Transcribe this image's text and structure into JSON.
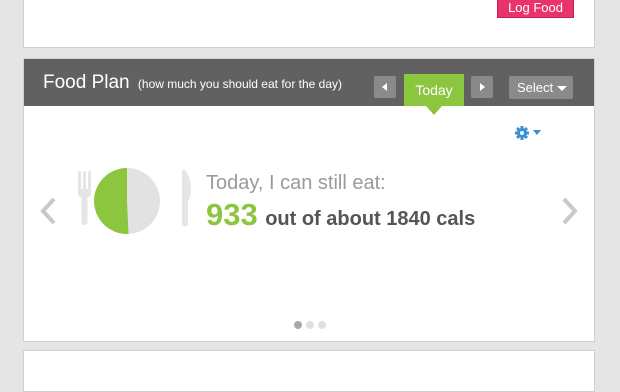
{
  "top_panel": {
    "log_food_label": "Log Food"
  },
  "food_plan": {
    "title": "Food Plan",
    "subtitle": "(how much you should eat for the day)",
    "today_label": "Today",
    "select_label": "Select",
    "remaining_label": "Today, I can still eat:",
    "calories_remaining": "933",
    "out_of_text": "out of about 1840 cals",
    "calories_remaining_value": 933,
    "calories_goal": 1840,
    "carousel_pages": 3,
    "active_page": 1
  },
  "colors": {
    "accent_green": "#8cc63f",
    "header_gray": "#616161",
    "log_food_pink": "#e8336b",
    "gear_blue": "#3a8fd9"
  },
  "icons": {
    "prev_day": "triangle-left-icon",
    "next_day": "triangle-right-icon",
    "select_caret": "caret-down-icon",
    "settings": "gear-icon",
    "carousel_prev": "chevron-left-icon",
    "carousel_next": "chevron-right-icon",
    "fork": "fork-icon",
    "knife": "knife-icon",
    "plate": "plate-pie-icon"
  }
}
